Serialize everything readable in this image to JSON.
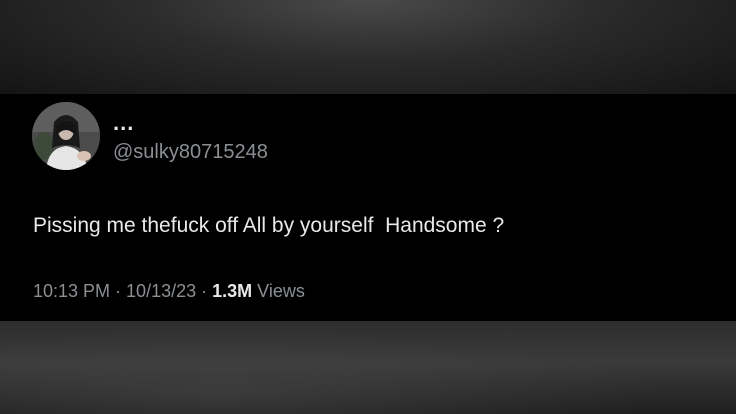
{
  "tweet": {
    "display_name": "...",
    "handle": "@sulky80715248",
    "text": "Pissing me thefuck off All by yourself  Handsome ?",
    "time": "10:13 PM",
    "separator": " · ",
    "date": "10/13/23",
    "views_count": "1.3M",
    "views_label": " Views"
  },
  "colors": {
    "background": "#000000",
    "primary_text": "#e7e9ea",
    "secondary_text": "#8b8f94"
  },
  "icons": {
    "avatar": "profile-photo-avatar"
  }
}
